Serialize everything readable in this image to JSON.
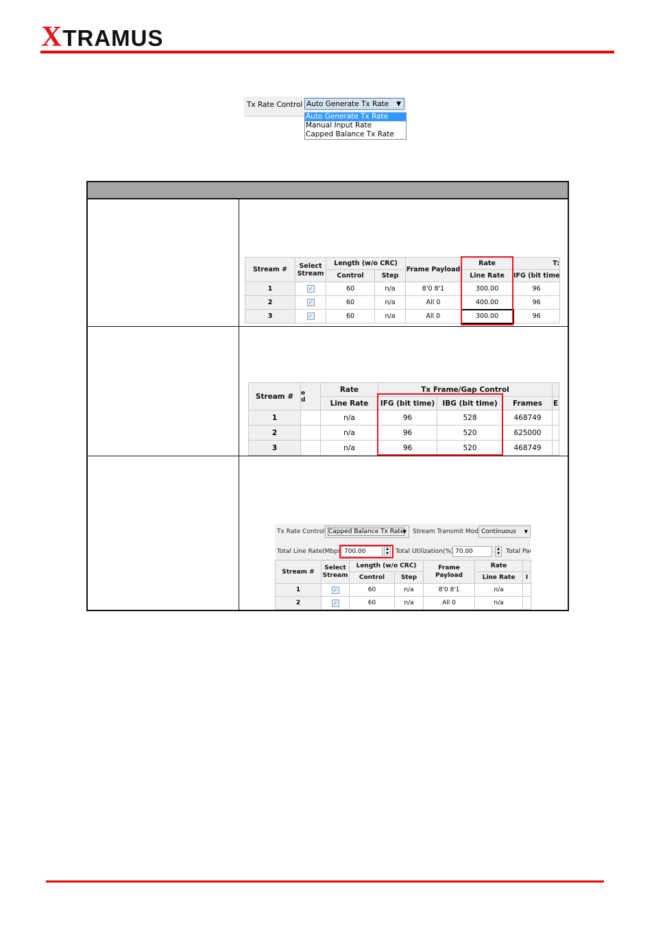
{
  "logo": {
    "text": "XTRAMUS",
    "first": "X",
    "rest": "TRAMUS"
  },
  "colors": {
    "brand_red": "#f00000",
    "highlight_red": "#e8141e",
    "selection_blue": "#3399ff"
  },
  "dropdown": {
    "label": "Tx Rate Control",
    "selected": "Auto Generate Tx Rate",
    "options": [
      "Auto Generate Tx Rate",
      "Manual Input Rate",
      "Capped Balance Tx Rate"
    ]
  },
  "shot1": {
    "headers": {
      "stream": "Stream #",
      "select": "Select Stream",
      "length": "Length (w/o CRC)",
      "control": "Control",
      "step": "Step",
      "payload": "Frame Payload",
      "rate": "Rate",
      "line_rate": "Line Rate",
      "tx": "T:",
      "ifg": "IFG (bit time"
    },
    "rows": [
      [
        "1",
        "✓",
        "60",
        "n/a",
        "8'0 8'1",
        "300.00",
        "96"
      ],
      [
        "2",
        "✓",
        "60",
        "n/a",
        "All 0",
        "400.00",
        "96"
      ],
      [
        "3",
        "✓",
        "60",
        "n/a",
        "All 0",
        "300.00",
        "96"
      ]
    ]
  },
  "shot2": {
    "headers": {
      "stream": "Stream #",
      "partial": "e\nd",
      "rate": "Rate",
      "line_rate": "Line Rate",
      "txgap": "Tx Frame/Gap Control",
      "ifg": "IFG (bit time)",
      "ibg": "IBG (bit time)",
      "frames": "Frames",
      "e": "E"
    },
    "rows": [
      [
        "1",
        "",
        "n/a",
        "96",
        "528",
        "468749",
        ""
      ],
      [
        "2",
        "",
        "n/a",
        "96",
        "520",
        "625000",
        ""
      ],
      [
        "3",
        "",
        "n/a",
        "96",
        "520",
        "468749",
        ""
      ]
    ]
  },
  "shot3": {
    "toolbar": {
      "rate_control_label": "Tx Rate Control",
      "rate_control_value": "Capped Balance Tx Rate",
      "mode_label": "Stream Transmit Mode",
      "mode_value": "Continuous",
      "total_line_rate_label": "Total Line Rate(Mbps)",
      "total_line_rate_value": "700.00",
      "total_util_label": "Total Utilization(%)",
      "total_util_value": "70.00",
      "total_pac_label": "Total Pac"
    },
    "headers": {
      "stream": "Stream #",
      "select": "Select Stream",
      "length": "Length (w/o CRC)",
      "control": "Control",
      "step": "Step",
      "payload": "Frame Payload",
      "rate": "Rate",
      "line_rate": "Line Rate",
      "i": "I"
    },
    "rows": [
      [
        "1",
        "✓",
        "60",
        "n/a",
        "8'0 8'1",
        "n/a",
        ""
      ],
      [
        "2",
        "✓",
        "60",
        "n/a",
        "All 0",
        "n/a",
        ""
      ]
    ]
  }
}
